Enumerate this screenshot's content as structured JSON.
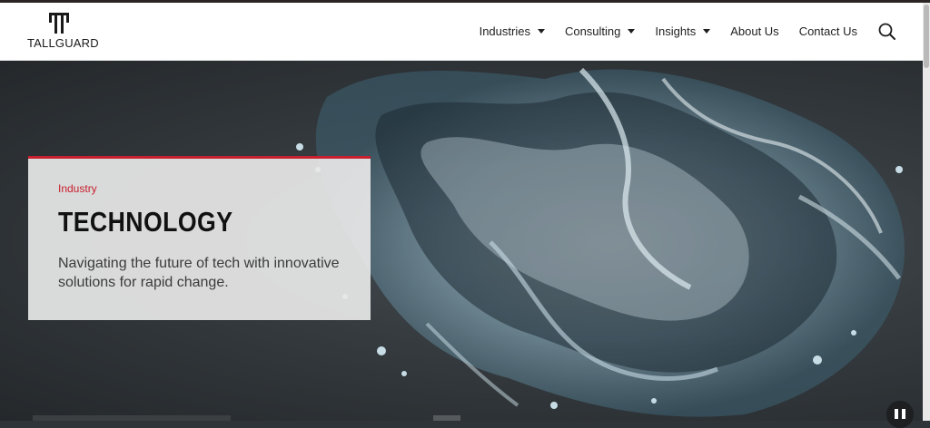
{
  "brand": {
    "name": "TALLGUARD"
  },
  "nav": {
    "items": [
      {
        "label": "Industries",
        "dropdown": true
      },
      {
        "label": "Consulting",
        "dropdown": true
      },
      {
        "label": "Insights",
        "dropdown": true
      },
      {
        "label": "About Us",
        "dropdown": false
      },
      {
        "label": "Contact Us",
        "dropdown": false
      }
    ],
    "search_icon": "search-icon"
  },
  "hero": {
    "eyebrow": "Industry",
    "title": "TECHNOLOGY",
    "description": "Navigating the future of tech with innovative solutions for rapid change.",
    "accent_color": "#c8202e",
    "background_image": "abstract liquid splash"
  },
  "controls": {
    "pause_icon": "pause-icon"
  }
}
